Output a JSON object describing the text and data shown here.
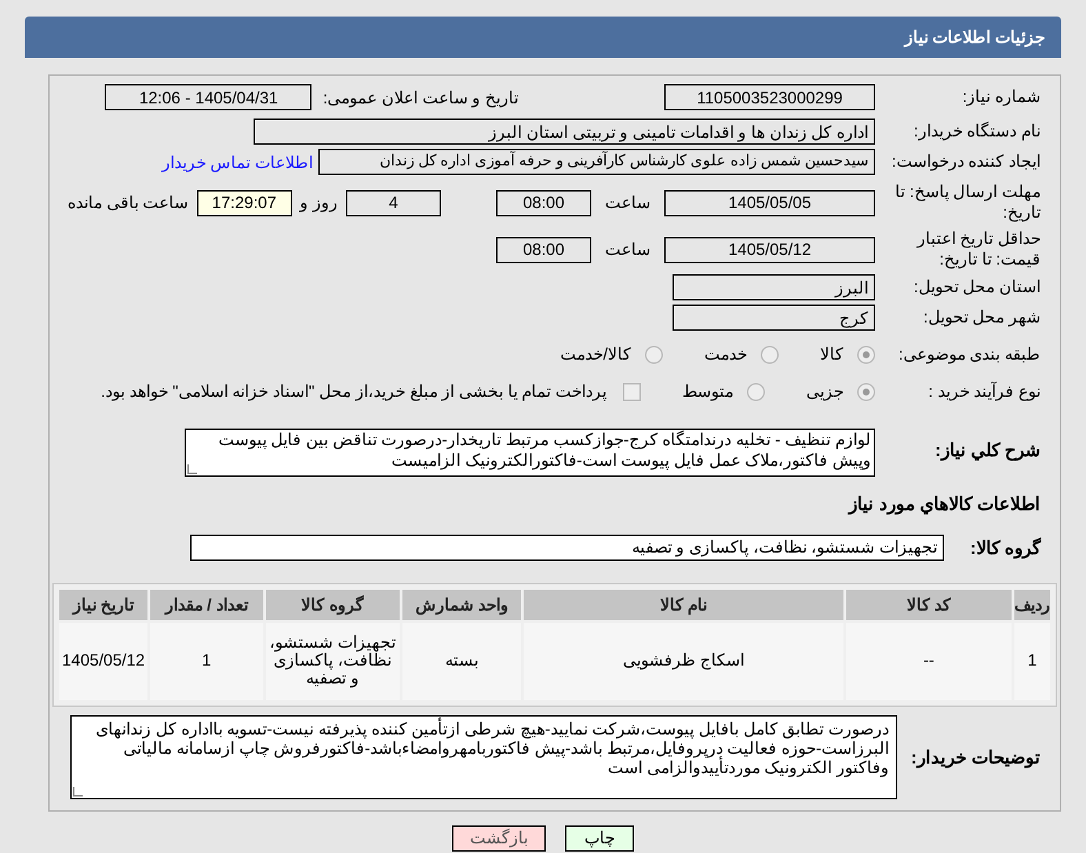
{
  "header": {
    "title": "جزئیات اطلاعات نیاز"
  },
  "need_number": {
    "label": "شماره نیاز:",
    "value": "1105003523000299"
  },
  "announce_datetime": {
    "label": "تاریخ و ساعت اعلان عمومی:",
    "value": "1405/04/31 - 12:06"
  },
  "buyer_org": {
    "label": "نام دستگاه خریدار:",
    "value": "اداره کل زندان ها و اقدامات تامینی و تربیتی استان البرز"
  },
  "requester": {
    "label": "ایجاد کننده درخواست:",
    "value": "سیدحسین شمس زاده علوی کارشناس کارآفرینی و حرفه آموزی اداره کل زندان",
    "contact_link": "اطلاعات تماس خریدار"
  },
  "reply_deadline": {
    "label": "مهلت ارسال پاسخ: تا تاریخ:",
    "date": "1405/05/05",
    "time_label": "ساعت",
    "time": "08:00",
    "days": "4",
    "days_label": "روز و",
    "remaining": "17:29:07",
    "remaining_label": "ساعت باقی مانده"
  },
  "price_validity": {
    "label": "حداقل تاریخ اعتبار قیمت: تا تاریخ:",
    "date": "1405/05/12",
    "time_label": "ساعت",
    "time": "08:00"
  },
  "province": {
    "label": "استان محل تحویل:",
    "value": "البرز"
  },
  "city": {
    "label": "شهر محل تحویل:",
    "value": "کرج"
  },
  "category": {
    "label": "طبقه بندی موضوعی:",
    "options": [
      {
        "label": "کالا",
        "selected": true
      },
      {
        "label": "خدمت",
        "selected": false
      },
      {
        "label": "کالا/خدمت",
        "selected": false
      }
    ]
  },
  "purchase_type": {
    "label": "نوع فرآیند خرید :",
    "options": [
      {
        "label": "جزیی",
        "selected": true
      },
      {
        "label": "متوسط",
        "selected": false
      }
    ],
    "payment_note": {
      "checked": false,
      "text": "پرداخت تمام یا بخشی از مبلغ خرید،از محل \"اسناد خزانه اسلامی\" خواهد بود."
    }
  },
  "description": {
    "label": "شرح کلي نياز:",
    "value": "لوازم تنظیف - تخلیه درندامتگاه کرج-جوازکسب مرتبط تاریخدار-درصورت تناقض بین فایل پیوست وپیش فاکتور،ملاک عمل فایل پیوست است-فاکتورالکترونیک الزامیست"
  },
  "goods_section": {
    "title": "اطلاعات كالاهاي مورد نياز",
    "group_label": "گروه کالا:",
    "group_value": "تجهیزات شستشو، نظافت، پاکسازی و تصفیه"
  },
  "table": {
    "columns": [
      "ردیف",
      "کد کالا",
      "نام کالا",
      "واحد شمارش",
      "گروه کالا",
      "تعداد / مقدار",
      "تاریخ نیاز"
    ],
    "rows": [
      [
        "1",
        "--",
        "اسکاج ظرفشویی",
        "بسته",
        "تجهیزات شستشو، نظافت، پاکسازی و تصفیه",
        "1",
        "1405/05/12"
      ]
    ]
  },
  "buyer_notes": {
    "label": "توضیحات خریدار:",
    "value": "درصورت تطابق کامل بافایل پیوست،شرکت نمایید-هیچ شرطی ازتأمین کننده پذیرفته نیست-تسویه بااداره کل زندانهای البرزاست-حوزه فعالیت درپروفایل،مرتبط باشد-پیش فاکتوربامهروامضاءباشد-فاکتورفروش چاپ ازسامانه مالیاتی وفاکتور الکترونیک موردتأییدوالزامی است"
  },
  "buttons": [
    {
      "label": "چاپ",
      "kind": "print"
    },
    {
      "label": "بازگشت",
      "kind": "back"
    }
  ]
}
